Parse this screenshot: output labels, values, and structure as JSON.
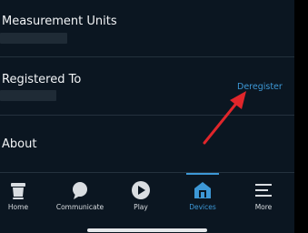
{
  "settings": {
    "measurement_units": {
      "title": "Measurement Units"
    },
    "registered_to": {
      "title": "Registered To",
      "action_label": "Deregister"
    },
    "about": {
      "title": "About"
    }
  },
  "bottom_nav": {
    "items": [
      {
        "label": "Home",
        "icon": "home-icon",
        "active": false
      },
      {
        "label": "Communicate",
        "icon": "communicate-icon",
        "active": false
      },
      {
        "label": "Play",
        "icon": "play-icon",
        "active": false
      },
      {
        "label": "Devices",
        "icon": "devices-icon",
        "active": true
      },
      {
        "label": "More",
        "icon": "more-icon",
        "active": false
      }
    ]
  },
  "colors": {
    "background": "#0b1621",
    "accent": "#3d98d6",
    "annotation_arrow": "#e0262b"
  }
}
